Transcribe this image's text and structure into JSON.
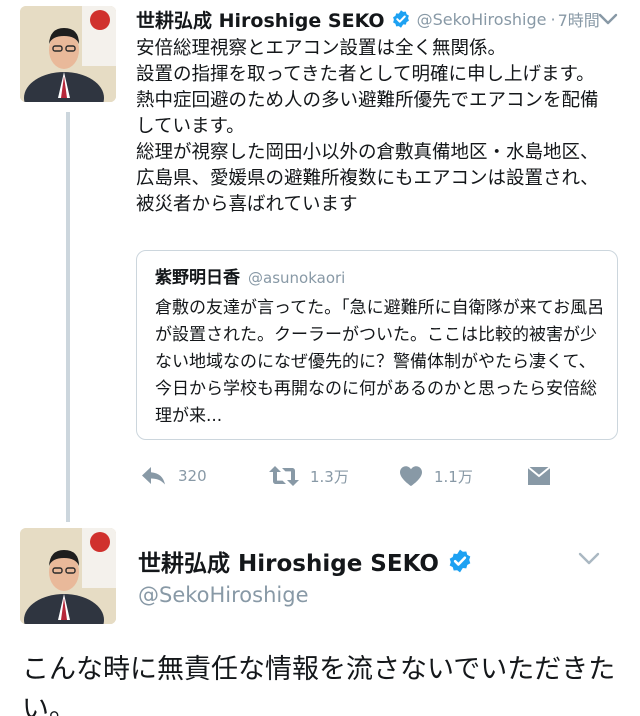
{
  "tweet": {
    "author_name": "世耕弘成 Hiroshige SEKO",
    "handle": "@SekoHiroshige",
    "separator": "·",
    "time": "7時間",
    "body_lines": [
      "安倍総理視察とエアコン設置は全く無関係。",
      "設置の指揮を取ってきた者として明確に申し上げます。",
      "熱中症回避のため人の多い避難所優先でエアコンを配備しています。",
      "総理が視察した岡田小以外の倉敷真備地区・水島地区、広島県、愛媛県の避難所複数にもエアコンは設置され、被災者から喜ばれています"
    ]
  },
  "quoted_tweet": {
    "author_name": "紫野明日香",
    "handle": "@asunokaori",
    "body": "倉敷の友達が言ってた。「急に避難所に自衛隊が来てお風呂が設置された。クーラーがついた。ここは比較的被害が少ない地域なのになぜ優先的に？警備体制がやたら凄くて、今日から学校も再開なのに何があるのかと思ったら安倍総理が来..."
  },
  "actions": {
    "reply_count": "320",
    "retweet_count": "1.3万",
    "like_count": "1.1万"
  },
  "reply_tweet": {
    "author_name": "世耕弘成 Hiroshige SEKO",
    "handle": "@SekoHiroshige",
    "body": "こんな時に無責任な情報を流さないでいただきたい。"
  },
  "icons": {
    "verified": "verified-badge-icon",
    "chevron": "chevron-down-icon",
    "reply": "reply-icon",
    "retweet": "retweet-icon",
    "like": "heart-icon",
    "dm": "envelope-icon"
  },
  "colors": {
    "verified_blue": "#1da1f2",
    "muted_gray": "#8899a6",
    "text": "#14171a",
    "border": "#ccd6dd"
  }
}
